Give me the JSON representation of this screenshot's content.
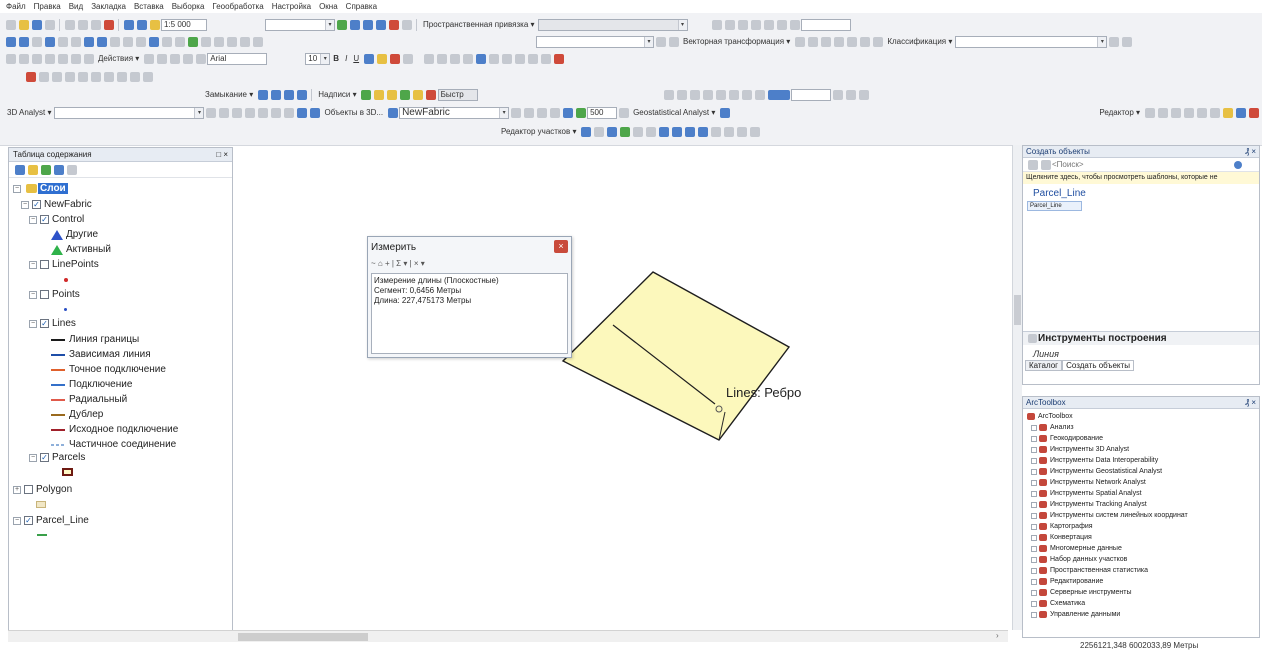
{
  "menu": [
    "Файл",
    "Правка",
    "Вид",
    "Закладка",
    "Вставка",
    "Выборка",
    "Геообработка",
    "Настройка",
    "Окна",
    "Справка"
  ],
  "toolbar": {
    "scale": "1:5 000",
    "spatial_adjust": "Пространственная привязка ▾",
    "vector_transform": "Векторная трансформация ▾",
    "classification": "Классификация ▾",
    "actions": "Действия ▾",
    "font": "Arial",
    "font_size": "10",
    "bold": "B",
    "italic": "I",
    "underline": "U",
    "snapping": "Замыкание ▾",
    "labels": "Надписи ▾",
    "fast": "Быстр",
    "analyst3d": "3D Analyst ▾",
    "objects3d": "Объекты в 3D...",
    "fabric": "NewFabric",
    "value500": "500",
    "geostat": "Geostatistical Analyst ▾",
    "editor": "Редактор ▾",
    "parcel_editor": "Редактор участков ▾"
  },
  "toc": {
    "title": "Таблица содержания",
    "close": "□ ×",
    "root": "Слои",
    "items": {
      "newfabric": "NewFabric",
      "control": "Control",
      "other": "Другие",
      "active": "Активный",
      "linepoints": "LinePoints",
      "points": "Points",
      "lines": "Lines",
      "boundary": "Линия границы",
      "dependent": "Зависимая линия",
      "precise": "Точное подключение",
      "connection": "Подключение",
      "radial": "Радиальный",
      "duplicate": "Дублер",
      "origin": "Исходное подключение",
      "partial": "Частичное соединение",
      "parcels": "Parcels",
      "polygon": "Polygon",
      "parcel_line": "Parcel_Line"
    }
  },
  "map": {
    "label": "Lines: Ребро"
  },
  "measure": {
    "title": "Измерить",
    "close": "×",
    "tools": "~ ⌂ + | Σ ▾ | × ▾",
    "lines": [
      "Измерение длины (Плоскостные)",
      "Сегмент: 0,6456 Метры",
      "Длина: 227,475173 Метры"
    ]
  },
  "create": {
    "title": "Создать объекты",
    "close": "₰ ×",
    "search_placeholder": "<Поиск>",
    "hint": "Щелкните здесь, чтобы просмотреть шаблоны, которые не",
    "template_group": "Parcel_Line",
    "template_item": "Parcel_Line",
    "construct_title": "Инструменты построения",
    "construct_line": "Линия",
    "catalog_tab": "Каталог",
    "create_tab": "Создать объекты"
  },
  "arctoolbox": {
    "title": "ArcToolbox",
    "close": "₰ ×",
    "root": "ArcToolbox",
    "items": [
      "Анализ",
      "Геокодирование",
      "Инструменты 3D Analyst",
      "Инструменты Data Interoperability",
      "Инструменты Geostatistical Analyst",
      "Инструменты Network Analyst",
      "Инструменты Spatial Analyst",
      "Инструменты Tracking Analyst",
      "Инструменты систем линейных координат",
      "Картография",
      "Конвертация",
      "Многомерные данные",
      "Набор данных участков",
      "Пространственная статистика",
      "Редактирование",
      "Серверные инструменты",
      "Схематика",
      "Управление данными"
    ]
  },
  "status": {
    "coords": "2256121,348  6002033,89 Метры"
  }
}
